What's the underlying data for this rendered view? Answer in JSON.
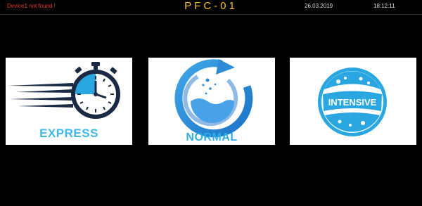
{
  "header": {
    "error_message": "Device1 not found !",
    "title": "PFC-01",
    "date": "26.03.2019",
    "time": "18:12:11"
  },
  "programs": [
    {
      "label": "EXPRESS",
      "icon": "stopwatch-icon"
    },
    {
      "label": "NORMAL",
      "icon": "refresh-flask-icon"
    },
    {
      "label": "INTENSIVE",
      "icon": "water-badge-icon"
    }
  ],
  "colors": {
    "background": "#000000",
    "title": "#f0c419",
    "error": "#e23b2a",
    "accent_blue": "#2aa7e0",
    "dark_navy": "#1b2a44"
  }
}
